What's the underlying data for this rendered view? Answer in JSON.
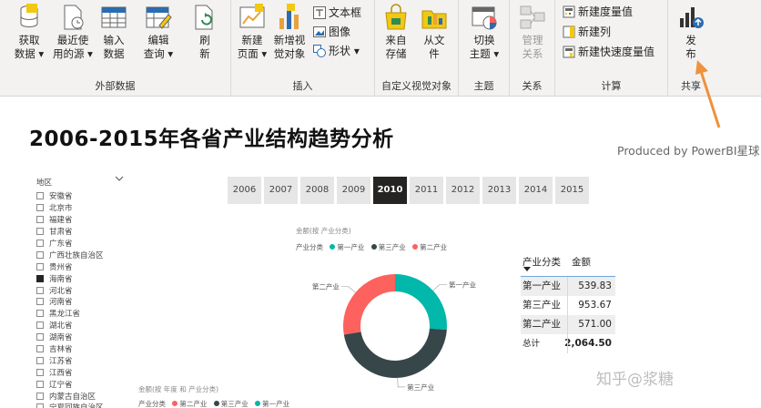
{
  "ribbon": {
    "external_data": {
      "label": "外部数据",
      "get_data": "获取\n数据 ▾",
      "recent_sources": "最近使\n用的源 ▾",
      "enter_data": "输入\n数据",
      "edit_queries": "编辑\n查询 ▾",
      "refresh": "刷\n新"
    },
    "insert": {
      "label": "插入",
      "new_page": "新建\n页面 ▾",
      "new_visual": "新增视\n觉对象",
      "textbox": "文本框",
      "image": "图像",
      "shapes": "形状 ▾"
    },
    "custom_visuals": {
      "label": "自定义视觉对象",
      "from_store": "来自\n存储",
      "from_file": "从文\n件"
    },
    "themes": {
      "label": "主题",
      "switch_theme": "切换\n主题 ▾"
    },
    "relationships": {
      "label": "关系",
      "manage": "管理\n关系"
    },
    "calculations": {
      "label": "计算",
      "new_measure": "新建度量值",
      "new_column": "新建列",
      "new_quick_measure": "新建快速度量值"
    },
    "share": {
      "label": "共享",
      "publish": "发\n布"
    }
  },
  "report": {
    "title": "2006-2015年各省产业结构趋势分析",
    "produced_by": "Produced by PowerBI星球"
  },
  "slicer": {
    "header": "地区",
    "items": [
      {
        "label": "安徽省",
        "checked": false
      },
      {
        "label": "北京市",
        "checked": false
      },
      {
        "label": "福建省",
        "checked": false
      },
      {
        "label": "甘肃省",
        "checked": false
      },
      {
        "label": "广东省",
        "checked": false
      },
      {
        "label": "广西壮族自治区",
        "checked": false
      },
      {
        "label": "贵州省",
        "checked": false
      },
      {
        "label": "海南省",
        "checked": true
      },
      {
        "label": "河北省",
        "checked": false
      },
      {
        "label": "河南省",
        "checked": false
      },
      {
        "label": "黑龙江省",
        "checked": false
      },
      {
        "label": "湖北省",
        "checked": false
      },
      {
        "label": "湖南省",
        "checked": false
      },
      {
        "label": "吉林省",
        "checked": false
      },
      {
        "label": "江苏省",
        "checked": false
      },
      {
        "label": "江西省",
        "checked": false
      },
      {
        "label": "辽宁省",
        "checked": false
      },
      {
        "label": "内蒙古自治区",
        "checked": false
      },
      {
        "label": "宁夏回族自治区",
        "checked": false
      }
    ]
  },
  "years": {
    "items": [
      "2006",
      "2007",
      "2008",
      "2009",
      "2010",
      "2011",
      "2012",
      "2013",
      "2014",
      "2015"
    ],
    "selected": "2010"
  },
  "donut": {
    "caption": "金额(按 产业分类)",
    "legend_title": "产业分类",
    "labels": {
      "first": "第一产业",
      "second": "第二产业",
      "third": "第三产业"
    }
  },
  "chart_data": {
    "type": "pie",
    "categories": [
      "第一产业",
      "第三产业",
      "第二产业"
    ],
    "values": [
      539.83,
      953.67,
      571.0
    ],
    "colors": [
      "#01b8aa",
      "#374649",
      "#fd625e"
    ],
    "title": "金额(按 产业分类)",
    "legend": "top-left"
  },
  "table": {
    "col1": "产业分类",
    "col2": "金额",
    "rows": [
      {
        "name": "第一产业",
        "value": "539.83"
      },
      {
        "name": "第三产业",
        "value": "953.67"
      },
      {
        "name": "第二产业",
        "value": "571.00"
      }
    ],
    "total_label": "总计",
    "total_value": "2,064.50"
  },
  "bottom_chart": {
    "caption": "金额(按 年度 和 产业分类)",
    "legend_title": "产业分类",
    "legend": [
      "第二产业",
      "第三产业",
      "第一产业"
    ]
  },
  "colors": {
    "first": "#01b8aa",
    "second": "#fd625e",
    "third": "#374649",
    "arrow": "#f0913b"
  },
  "watermark": "知乎@浆糖"
}
